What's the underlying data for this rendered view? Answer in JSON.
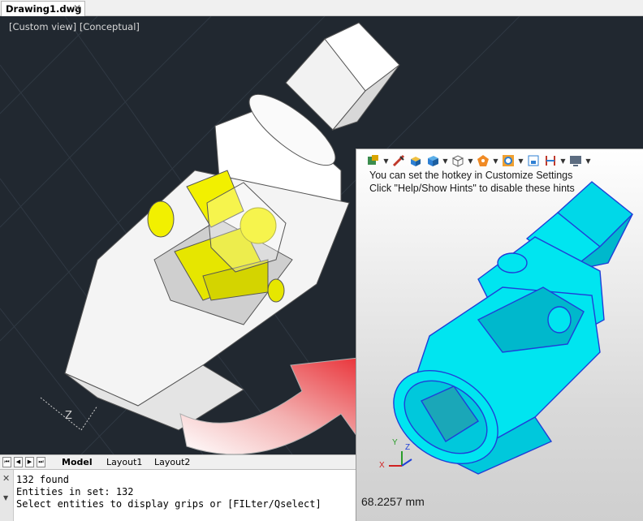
{
  "document_tab": {
    "title": "Drawing1.dwg",
    "close_glyph": "✕"
  },
  "viewport": {
    "view_label": "[Custom view] [Conceptual]",
    "background": "#212830"
  },
  "overlay": {
    "hint_line_1": "You can set the hotkey in Customize Settings",
    "hint_line_2": "Click \"Help/Show Hints\" to disable these hints",
    "measurement": "68.2257 mm",
    "toolbar": [
      "layers-icon",
      "pen-icon",
      "box-icon",
      "solid-icon",
      "cube-icon",
      "sphere-icon",
      "target-icon",
      "view-icon",
      "dimension-icon",
      "display-icon"
    ],
    "axis": {
      "x": "X",
      "y": "Y",
      "z": "Z"
    }
  },
  "layout_tabs": {
    "model": "Model",
    "layout1": "Layout1",
    "layout2": "Layout2"
  },
  "nav": {
    "first": "⏮",
    "prev": "◀",
    "next": "▶",
    "last": "⏭"
  },
  "command": {
    "close_glyph": "✕",
    "line1": "132 found",
    "line2": "Entities in set: 132",
    "line3": "Select entities to display grips or [FILter/Qselect]"
  },
  "colors": {
    "cyan_model": "#00e5f0",
    "yellow_part": "#f2f000",
    "arrow_red": "#e8232a"
  }
}
